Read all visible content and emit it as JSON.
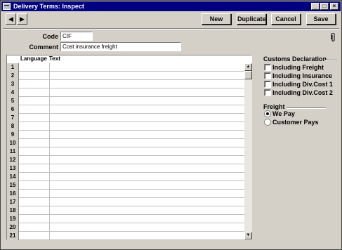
{
  "window": {
    "title": "Delivery Terms: Inspect",
    "controls": [
      "_",
      "□",
      "×"
    ]
  },
  "toolbar": {
    "prev_icon": "◀",
    "next_icon": "▶",
    "new_label": "New",
    "duplicate_label": "Duplicate",
    "cancel_label": "Cancel",
    "save_label": "Save"
  },
  "form": {
    "code_label": "Code",
    "code_value": "CIF",
    "comment_label": "Comment",
    "comment_value": "Cost insurance freight",
    "attachment_icon": "paperclip-icon"
  },
  "grid": {
    "columns": [
      "Language",
      "Text"
    ],
    "row_numbers": [
      "1",
      "2",
      "3",
      "4",
      "5",
      "6",
      "7",
      "8",
      "9",
      "10",
      "11",
      "12",
      "13",
      "14",
      "15",
      "16",
      "17",
      "18",
      "19",
      "20",
      "21"
    ],
    "scroll_up": "▲",
    "scroll_down": "▼"
  },
  "customs": {
    "title": "Customs Declaration",
    "options": [
      {
        "label": "Including Freight",
        "checked": false
      },
      {
        "label": "Including Insurance",
        "checked": false
      },
      {
        "label": "Including Div.Cost 1",
        "checked": false
      },
      {
        "label": "Including Div.Cost 2",
        "checked": false
      }
    ]
  },
  "freight": {
    "title": "Freight",
    "options": [
      {
        "label": "We Pay",
        "selected": true
      },
      {
        "label": "Customer Pays",
        "selected": false
      }
    ]
  }
}
